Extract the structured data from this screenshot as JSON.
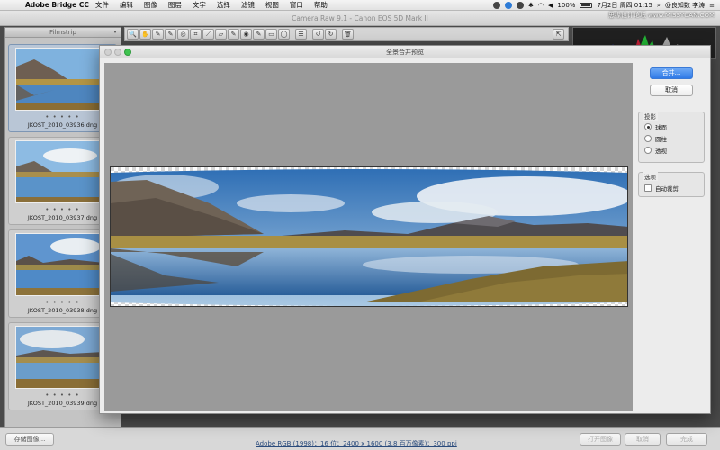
{
  "menubar": {
    "app_name": "Adobe Bridge CC",
    "items": [
      "文件",
      "编辑",
      "图像",
      "图层",
      "文字",
      "选择",
      "滤镜",
      "视图",
      "窗口",
      "帮助"
    ],
    "battery": "100%",
    "datetime": "7月2日 周四 01:15",
    "user": "@良知数 李涛"
  },
  "camera_raw": {
    "window_title": "Camera Raw 9.1 - Canon EOS 5D Mark II",
    "filmstrip_title": "Filmstrip",
    "thumbnails": [
      {
        "filename": "JKOST_2010_03936.dng",
        "rating": "• • • • •"
      },
      {
        "filename": "JKOST_2010_03937.dng",
        "rating": "• • • • •"
      },
      {
        "filename": "JKOST_2010_03938.dng",
        "rating": "• • • • •"
      },
      {
        "filename": "JKOST_2010_03939.dng",
        "rating": "• • • • •"
      }
    ],
    "bottom": {
      "save_button": "存储图像...",
      "workflow_link": "Adobe RGB (1998)；16 位；2400 x 1600 (3.8 百万像素)；300 ppi",
      "open_button": "打开图像",
      "cancel_button": "取消",
      "done_button": "完成"
    }
  },
  "dialog": {
    "title": "全景合并预览",
    "merge_button": "合并...",
    "cancel_button": "取消",
    "projection": {
      "title": "投影",
      "options": [
        {
          "label": "球面",
          "selected": true
        },
        {
          "label": "圆柱",
          "selected": false
        },
        {
          "label": "透视",
          "selected": false
        }
      ]
    },
    "options": {
      "title": "选项",
      "auto_crop_label": "自动裁剪",
      "auto_crop_checked": false
    }
  },
  "watermark": "思缘设计论坛 www.MISSYUAN.COM"
}
